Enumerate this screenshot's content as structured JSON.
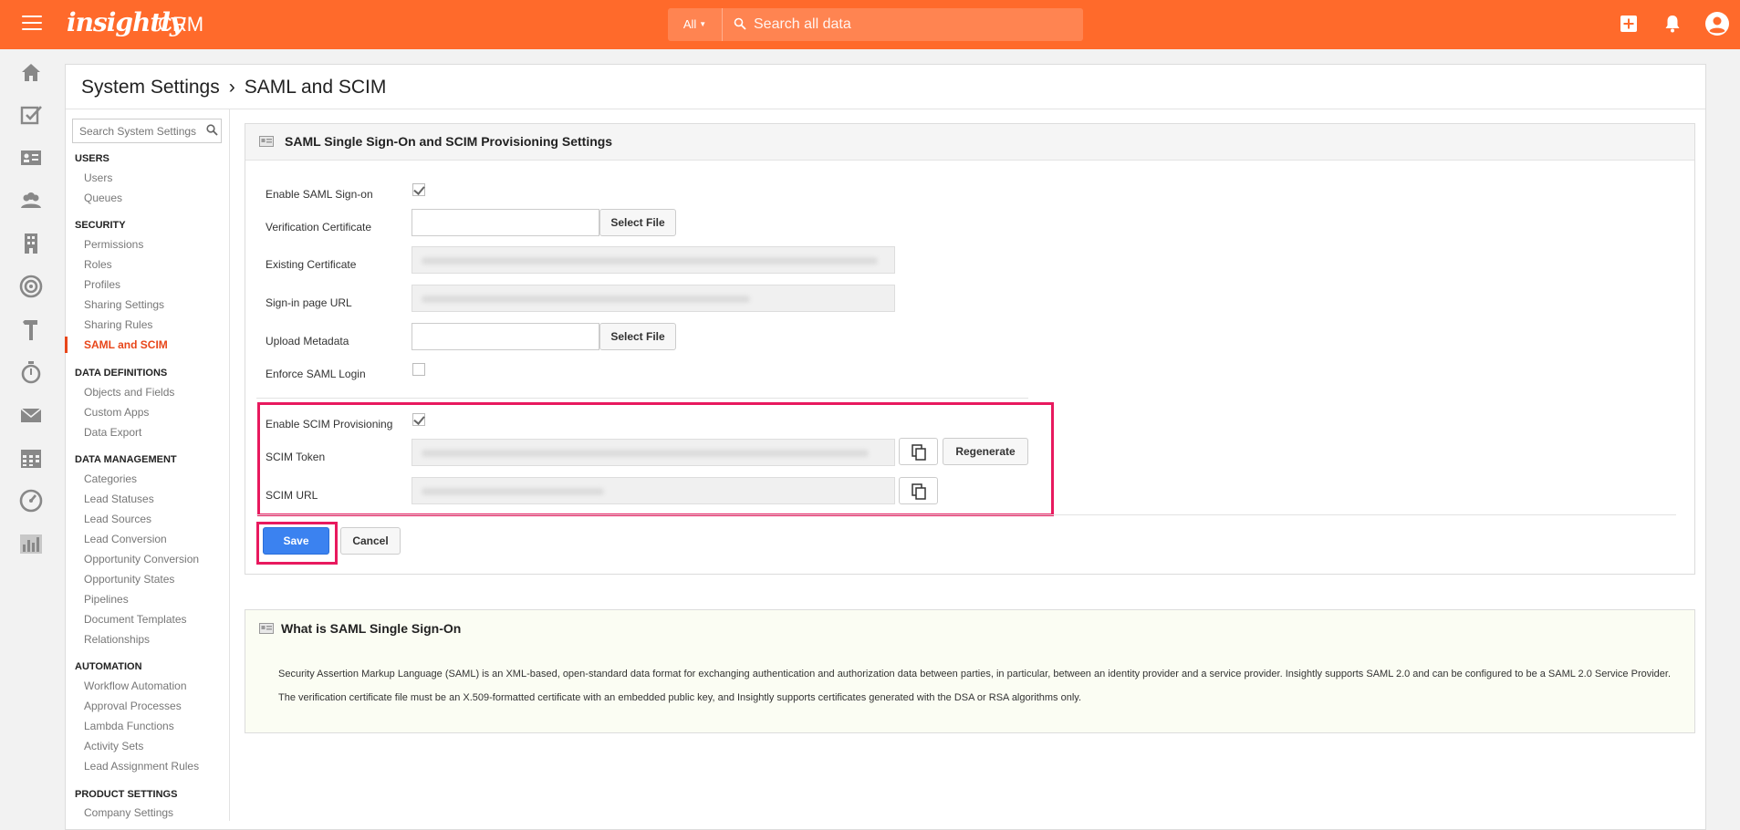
{
  "app": {
    "logo": "insightly",
    "product": "CRM"
  },
  "search": {
    "scope": "All",
    "placeholder": "Search all data"
  },
  "breadcrumb": {
    "root": "System Settings",
    "separator": "›",
    "current": "SAML and SCIM"
  },
  "settings_search": {
    "placeholder": "Search System Settings"
  },
  "menu": {
    "users": {
      "heading": "USERS",
      "items": [
        "Users",
        "Queues"
      ]
    },
    "security": {
      "heading": "SECURITY",
      "items": [
        "Permissions",
        "Roles",
        "Profiles",
        "Sharing Settings",
        "Sharing Rules",
        "SAML and SCIM"
      ]
    },
    "data_definitions": {
      "heading": "DATA DEFINITIONS",
      "items": [
        "Objects and Fields",
        "Custom Apps",
        "Data Export"
      ]
    },
    "data_management": {
      "heading": "DATA MANAGEMENT",
      "items": [
        "Categories",
        "Lead Statuses",
        "Lead Sources",
        "Lead Conversion",
        "Opportunity Conversion",
        "Opportunity States",
        "Pipelines",
        "Document Templates",
        "Relationships"
      ]
    },
    "automation": {
      "heading": "AUTOMATION",
      "items": [
        "Workflow Automation",
        "Approval Processes",
        "Lambda Functions",
        "Activity Sets",
        "Lead Assignment Rules"
      ]
    },
    "product_settings": {
      "heading": "PRODUCT SETTINGS",
      "items": [
        "Company Settings"
      ]
    }
  },
  "saml_card": {
    "title": "SAML Single Sign-On and SCIM Provisioning Settings",
    "enable_saml_label": "Enable SAML Sign-on",
    "enable_saml_checked": true,
    "verification_cert_label": "Verification Certificate",
    "select_file_label": "Select File",
    "existing_cert_label": "Existing Certificate",
    "signin_url_label": "Sign-in page URL",
    "upload_metadata_label": "Upload Metadata",
    "enforce_saml_label": "Enforce SAML Login",
    "enforce_saml_checked": false,
    "enable_scim_label": "Enable SCIM Provisioning",
    "enable_scim_checked": true,
    "scim_token_label": "SCIM Token",
    "regenerate_label": "Regenerate",
    "scim_url_label": "SCIM URL",
    "save_label": "Save",
    "cancel_label": "Cancel"
  },
  "info_card": {
    "title": "What is SAML Single Sign-On",
    "paragraph1": "Security Assertion Markup Language (SAML) is an XML-based, open-standard data format for exchanging authentication and authorization data between parties, in particular, between an identity provider and a service provider. Insightly supports SAML 2.0 and can be configured to be a SAML 2.0 Service Provider.",
    "paragraph2": "The verification certificate file must be an X.509-formatted certificate with an embedded public key, and Insightly supports certificates generated with the DSA or RSA algorithms only."
  },
  "colors": {
    "brand": "#ff6a2b",
    "active": "#e8461a",
    "highlight": "#e8195e",
    "primary_button": "#3b82f0"
  }
}
